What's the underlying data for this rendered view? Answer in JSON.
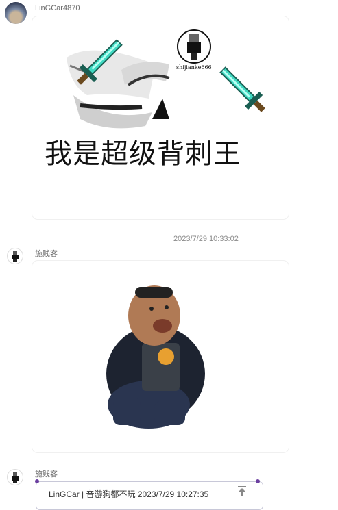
{
  "messages": [
    {
      "sender": "LinGCar4870"
    },
    {
      "sender": "施贱客",
      "time": "2023/7/29 10:33:02"
    },
    {
      "sender": "施贱客"
    }
  ],
  "sticker1": {
    "caption": "我是超级背刺王",
    "watermark": "shijianke666"
  },
  "reply": {
    "text": "LinGCar | 音游狗都不玩  2023/7/29 10:27:35"
  },
  "icons": [
    "diamond-sword-icon",
    "scroll-to-top-icon",
    "avatar-icon"
  ],
  "colors": {
    "sword": "#3fd9c2",
    "sword_dark": "#1a5e52",
    "sword_handle": "#6b4a1f",
    "quote_dot": "#6b3fa0"
  }
}
